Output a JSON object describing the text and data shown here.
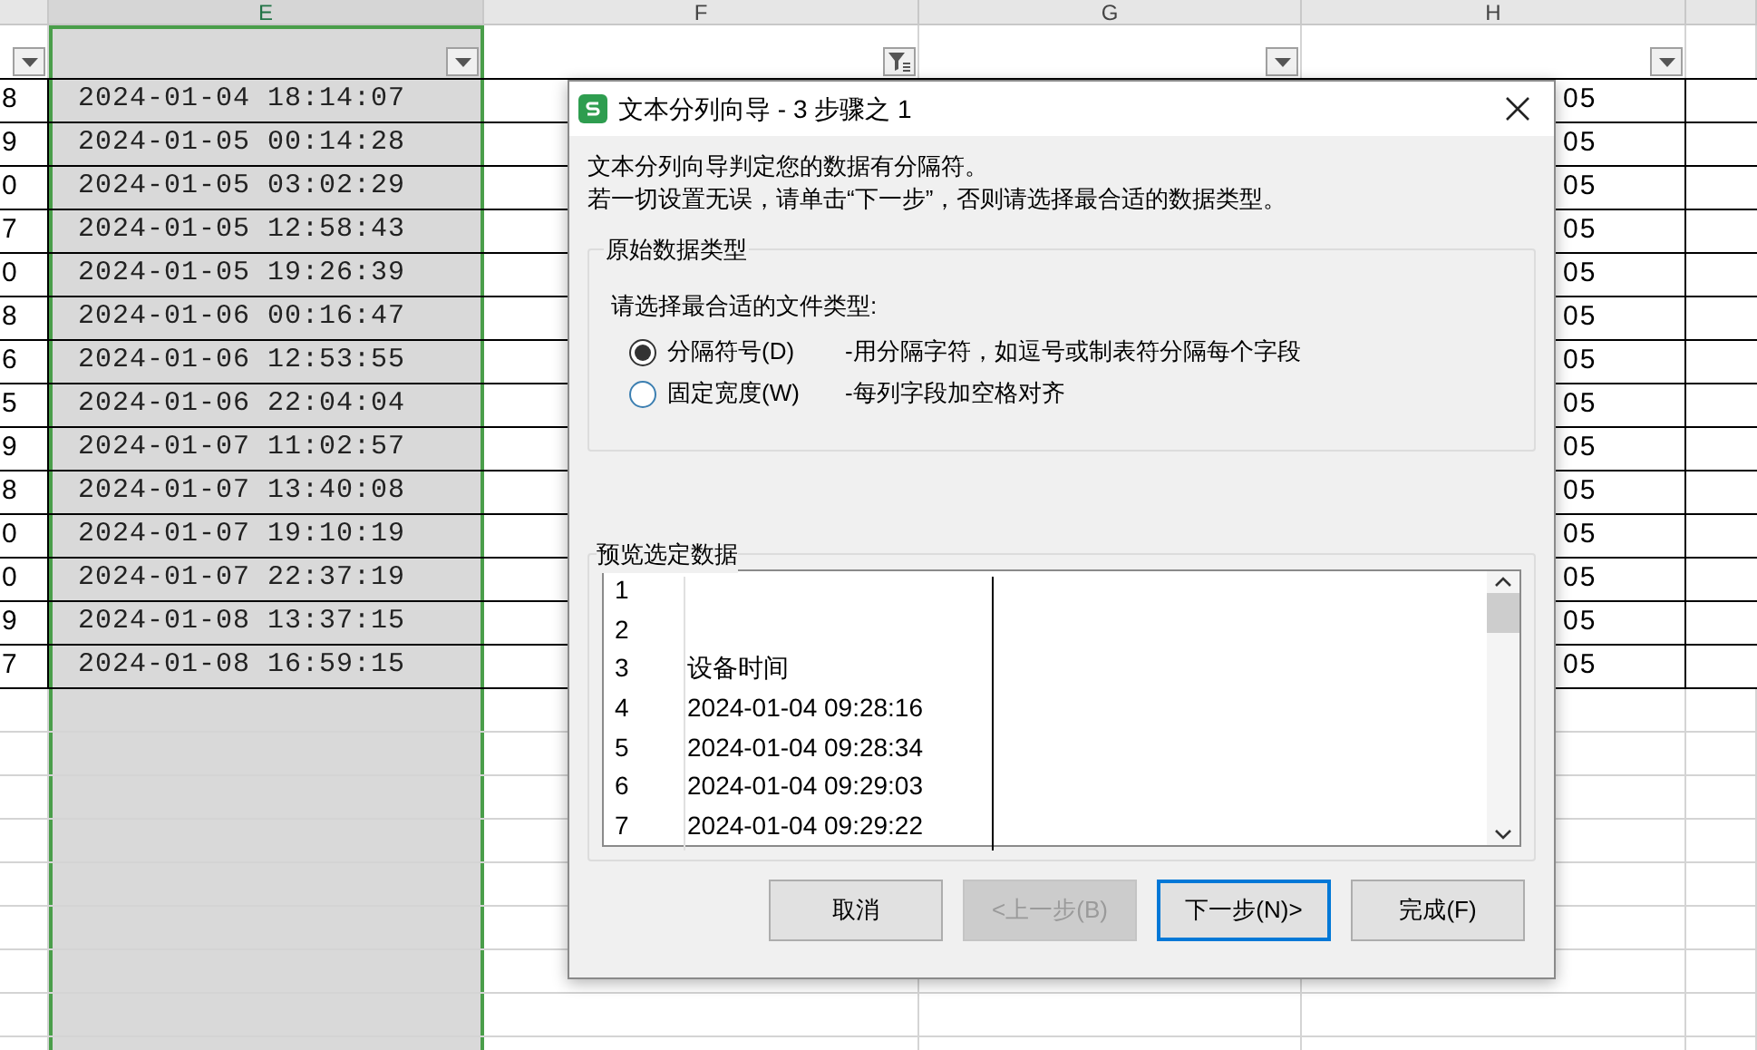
{
  "sheet": {
    "columns": [
      {
        "selected": false,
        "filter_button": true,
        "filtered": false
      },
      {
        "letter": "E",
        "selected": true,
        "filter_button": true,
        "filtered": false
      },
      {
        "letter": "F",
        "selected": false,
        "filter_button": true,
        "filtered": true
      },
      {
        "letter": "G",
        "selected": false,
        "filter_button": true,
        "filtered": false
      },
      {
        "letter": "H",
        "selected": false,
        "filter_button": true,
        "filtered": false
      },
      {
        "selected": false,
        "filter_button": false
      }
    ],
    "rows": [
      {
        "column_1": "8",
        "column_e": "2024-01-04 18:14:07",
        "column_h": "05"
      },
      {
        "column_1": "9",
        "column_e": "2024-01-05 00:14:28",
        "column_h": "05"
      },
      {
        "column_1": "0",
        "column_e": "2024-01-05 03:02:29",
        "column_h": "05"
      },
      {
        "column_1": "7",
        "column_e": "2024-01-05 12:58:43",
        "column_h": "05"
      },
      {
        "column_1": "0",
        "column_e": "2024-01-05 19:26:39",
        "column_h": "05"
      },
      {
        "column_1": "8",
        "column_e": "2024-01-06 00:16:47",
        "column_h": "05"
      },
      {
        "column_1": "6",
        "column_e": "2024-01-06 12:53:55",
        "column_h": "05"
      },
      {
        "column_1": "5",
        "column_e": "2024-01-06 22:04:04",
        "column_h": "05"
      },
      {
        "column_1": "9",
        "column_e": "2024-01-07 11:02:57",
        "column_h": "05"
      },
      {
        "column_1": "8",
        "column_e": "2024-01-07 13:40:08",
        "column_h": "05"
      },
      {
        "column_1": "0",
        "column_e": "2024-01-07 19:10:19",
        "column_h": "05"
      },
      {
        "column_1": "0",
        "column_e": "2024-01-07 22:37:19",
        "column_h": "05"
      },
      {
        "column_1": "9",
        "column_e": "2024-01-08 13:37:15",
        "column_h": "05"
      },
      {
        "column_1": "7",
        "column_e": "2024-01-08 16:59:15",
        "column_h": "05"
      }
    ]
  },
  "dialog": {
    "title": "文本分列向导 - 3 步骤之 1",
    "intro": [
      "文本分列向导判定您的数据有分隔符。",
      "若一切设置无误，请单击“下一步”，否则请选择最合适的数据类型。"
    ],
    "group": {
      "title": "原始数据类型",
      "prompt": "请选择最合适的文件类型:",
      "options": [
        {
          "label": "分隔符号(D)",
          "description": "-用分隔字符，如逗号或制表符分隔每个字段",
          "selected": true
        },
        {
          "label": "固定宽度(W)",
          "description": "-每列字段加空格对齐",
          "selected": false
        }
      ]
    },
    "preview": {
      "title": "预览选定数据",
      "rows": [
        {
          "number": "1"
        },
        {
          "number": "2"
        },
        {
          "number": "3",
          "text": "设备时间"
        },
        {
          "number": "4",
          "text": "2024-01-04 09:28:16"
        },
        {
          "number": "5",
          "text": "2024-01-04 09:28:34"
        },
        {
          "number": "6",
          "text": "2024-01-04 09:29:03"
        },
        {
          "number": "7",
          "text": "2024-01-04 09:29:22"
        }
      ]
    },
    "buttons": [
      {
        "label": "取消",
        "disabled": false,
        "focused": false
      },
      {
        "label": "<上一步(B)",
        "disabled": true,
        "focused": false
      },
      {
        "label": "下一步(N)>",
        "disabled": false,
        "focused": true
      },
      {
        "label": "完成(F)",
        "disabled": false,
        "focused": false
      }
    ]
  }
}
